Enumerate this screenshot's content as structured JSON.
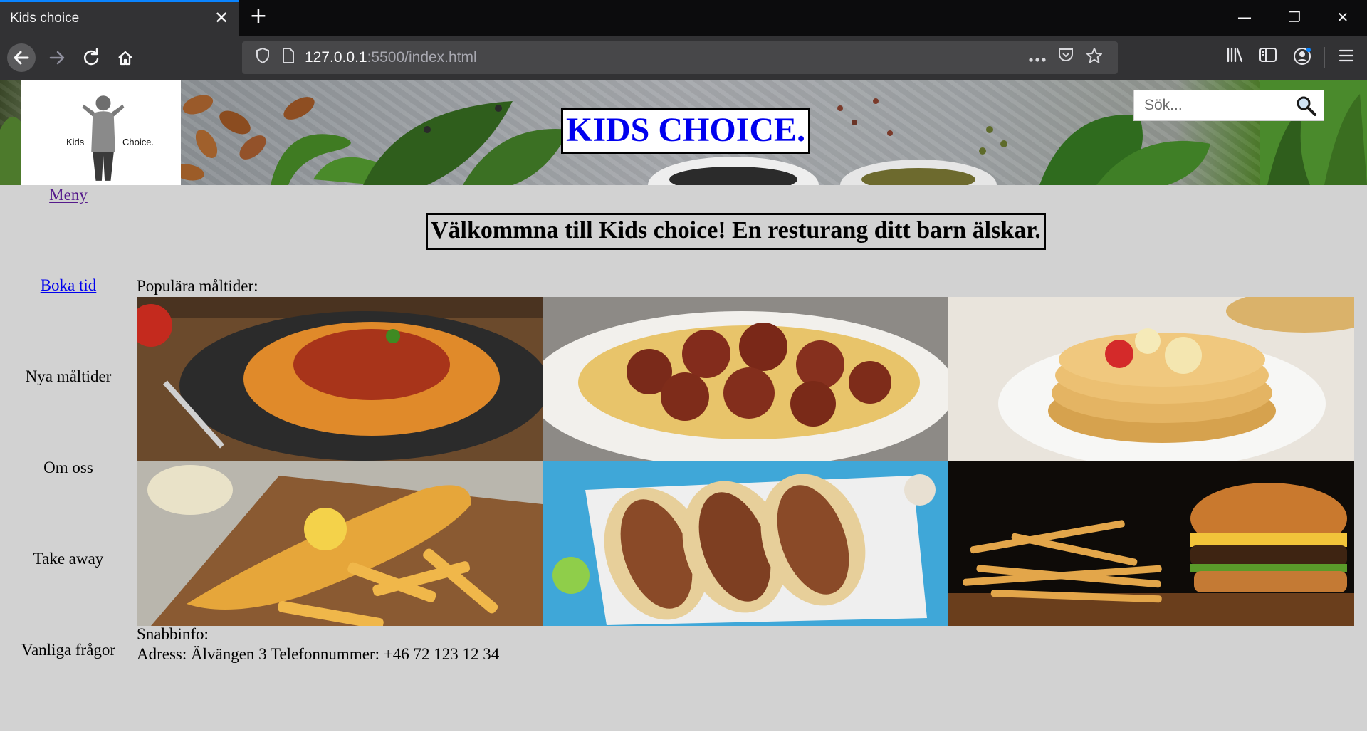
{
  "browser": {
    "tab_title": "Kids choice",
    "tab_close": "✕",
    "new_tab": "+",
    "url_host": "127.0.0.1",
    "url_rest": ":5500/index.html",
    "window_controls": {
      "minimize": "—",
      "restore": "❐",
      "close": "✕"
    },
    "icons": [
      "back-arrow-icon",
      "forward-arrow-icon",
      "reload-icon",
      "home-icon",
      "shield-icon",
      "page-icon",
      "more-icon",
      "pocket-icon",
      "star-icon",
      "library-icon",
      "sidebar-icon",
      "account-icon",
      "hamburger-menu-icon"
    ]
  },
  "header": {
    "logo_left": "Kids",
    "logo_right": "Choice.",
    "site_title": "KIDS CHOICE.",
    "search_placeholder": "Sök..."
  },
  "sidebar": {
    "items": [
      {
        "label": "Meny"
      },
      {
        "label": "Boka tid"
      },
      {
        "label": "Nya måltider"
      },
      {
        "label": "Om oss"
      },
      {
        "label": "Take away"
      },
      {
        "label": "Vanliga frågor"
      }
    ]
  },
  "main": {
    "welcome": "Välkommna till Kids choice! En resturang ditt barn älskar.",
    "popular_label": "Populära måltider:",
    "foods": [
      "spaghetti-bolognese",
      "spaghetti-meatballs",
      "pancakes",
      "fish-and-chips",
      "tacos",
      "burger-and-fries"
    ]
  },
  "info": {
    "title": "Snabbinfo:",
    "line": "Adress: Älvängen 3 Telefonnummer: +46 72 123 12 34"
  }
}
